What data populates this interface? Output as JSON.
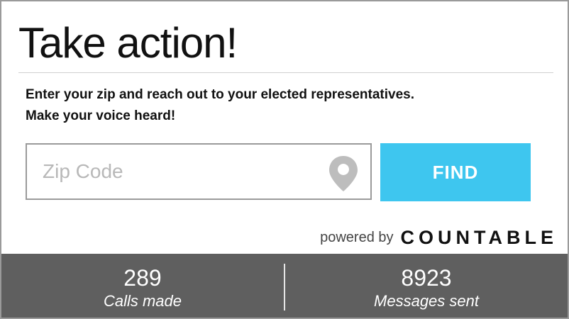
{
  "widget": {
    "title": "Take action!",
    "description_lines": [
      "Enter your zip and reach out to your elected representatives.",
      "Make your voice heard!"
    ],
    "zip": {
      "placeholder": "Zip Code",
      "value": "",
      "icon": "map-pin-icon"
    },
    "find_label": "FIND",
    "powered_by": {
      "label": "powered by",
      "brand": "COUNTABLE"
    },
    "stats": [
      {
        "value": "289",
        "label": "Calls made"
      },
      {
        "value": "8923",
        "label": "Messages sent"
      }
    ],
    "colors": {
      "accent": "#3ec6ef",
      "stats_background": "#5f5f5f",
      "border": "#9a9a9a",
      "placeholder": "#b8b8b8",
      "icon": "#bdbdbd"
    }
  }
}
